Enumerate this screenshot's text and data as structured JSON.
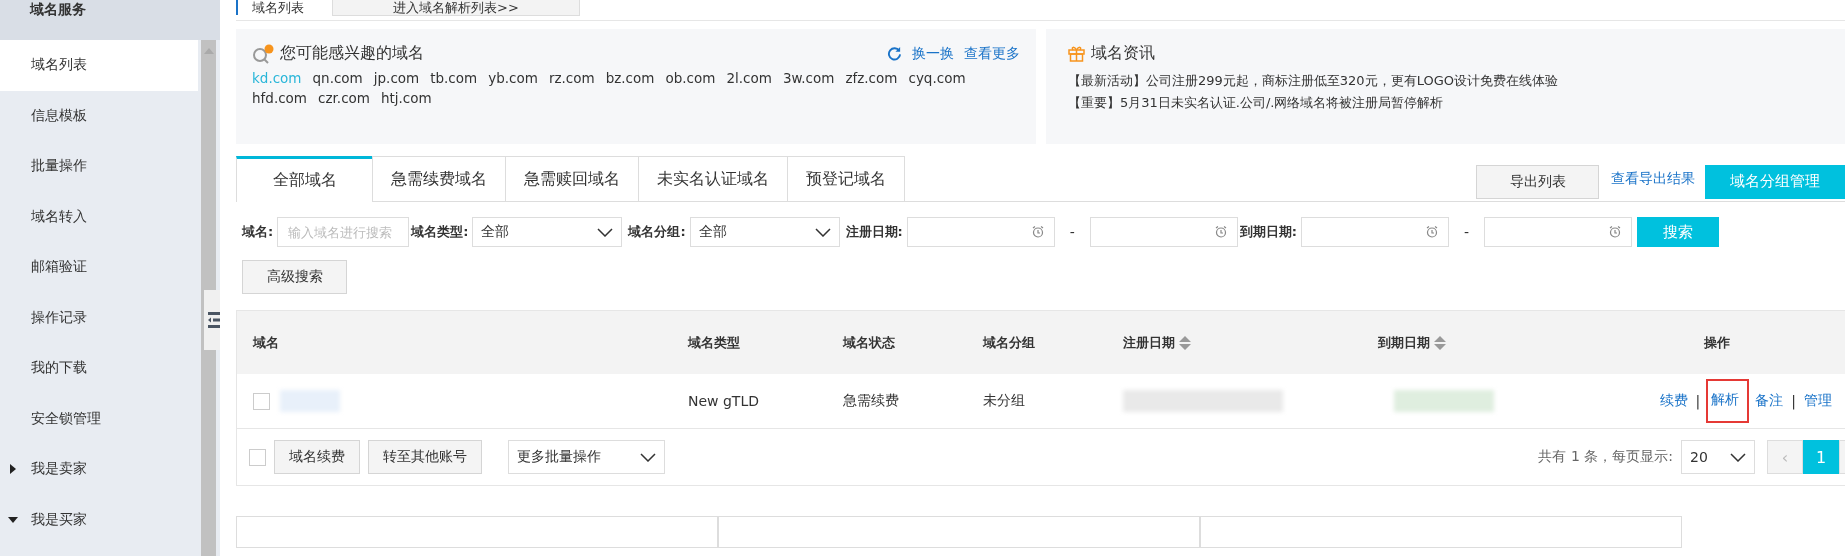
{
  "sidebar": {
    "title": "域名服务",
    "items": [
      {
        "label": "域名列表",
        "kind": "link",
        "selected": true
      },
      {
        "label": "信息模板",
        "kind": "link",
        "selected": false
      },
      {
        "label": "批量操作",
        "kind": "link",
        "selected": false
      },
      {
        "label": "域名转入",
        "kind": "link",
        "selected": false
      },
      {
        "label": "邮箱验证",
        "kind": "link",
        "selected": false
      },
      {
        "label": "操作记录",
        "kind": "link",
        "selected": false
      },
      {
        "label": "我的下载",
        "kind": "link",
        "selected": false
      },
      {
        "label": "安全锁管理",
        "kind": "link",
        "selected": false
      },
      {
        "label": "我是卖家",
        "kind": "group",
        "expanded": false,
        "selected": false
      },
      {
        "label": "我是买家",
        "kind": "group",
        "expanded": true,
        "selected": false
      }
    ]
  },
  "top_tabs": [
    {
      "label": "域名列表",
      "selected": true
    },
    {
      "label": "进入域名解析列表>>",
      "selected": false
    }
  ],
  "suggest": {
    "title": "您可能感兴趣的域名",
    "refresh": "换一换",
    "more": "查看更多",
    "domains": [
      {
        "name": "kd.com",
        "highlighted": true
      },
      {
        "name": "qn.com",
        "highlighted": false
      },
      {
        "name": "jp.com",
        "highlighted": false
      },
      {
        "name": "tb.com",
        "highlighted": false
      },
      {
        "name": "yb.com",
        "highlighted": false
      },
      {
        "name": "rz.com",
        "highlighted": false
      },
      {
        "name": "bz.com",
        "highlighted": false
      },
      {
        "name": "ob.com",
        "highlighted": false
      },
      {
        "name": "2l.com",
        "highlighted": false
      },
      {
        "name": "3w.com",
        "highlighted": false
      },
      {
        "name": "zfz.com",
        "highlighted": false
      },
      {
        "name": "cyq.com",
        "highlighted": false
      },
      {
        "name": "hfd.com",
        "highlighted": false
      },
      {
        "name": "czr.com",
        "highlighted": false
      },
      {
        "name": "htj.com",
        "highlighted": false
      }
    ]
  },
  "news": {
    "title": "域名资讯",
    "items": [
      "【最新活动】公司注册299元起，商标注册低至320元，更有LOGO设计免费在线体验",
      "【重要】5月31日未实名认证.公司/.网络域名将被注册局暂停解析"
    ]
  },
  "tabs": [
    {
      "label": "全部域名",
      "selected": true
    },
    {
      "label": "急需续费域名",
      "selected": false
    },
    {
      "label": "急需赎回域名",
      "selected": false
    },
    {
      "label": "未实名认证域名",
      "selected": false
    },
    {
      "label": "预登记域名",
      "selected": false
    }
  ],
  "toolbar": {
    "export": "导出列表",
    "export_result": "查看导出结果",
    "group_manage": "域名分组管理"
  },
  "filters": {
    "domain": {
      "label": "域名:",
      "placeholder": "输入域名进行搜索"
    },
    "type": {
      "label": "域名类型:",
      "value": "全部"
    },
    "group": {
      "label": "域名分组:",
      "value": "全部"
    },
    "reg_date": {
      "label": "注册日期:",
      "separator": "-"
    },
    "exp_date": {
      "label": "到期日期:",
      "separator": "-"
    },
    "search": "搜索",
    "advanced": "高级搜索"
  },
  "table": {
    "columns": [
      {
        "label": "域名",
        "sortable": false
      },
      {
        "label": "域名类型",
        "sortable": false
      },
      {
        "label": "域名状态",
        "sortable": false
      },
      {
        "label": "域名分组",
        "sortable": false
      },
      {
        "label": "注册日期",
        "sortable": true
      },
      {
        "label": "到期日期",
        "sortable": true
      },
      {
        "label": "操作",
        "sortable": false
      }
    ],
    "rows": [
      {
        "checked": false,
        "type": "New gTLD",
        "status": "急需续费",
        "group": "未分组",
        "actions": [
          {
            "label": "续费",
            "highlighted": false,
            "separator": "|"
          },
          {
            "label": "解析",
            "highlighted": true
          },
          {
            "label": "备注",
            "highlighted": false,
            "separator": "|"
          },
          {
            "label": "管理",
            "highlighted": false
          }
        ]
      }
    ]
  },
  "footer": {
    "select_all_checked": false,
    "buttons": [
      "域名续费",
      "转至其他账号"
    ],
    "batch": "更多批量操作",
    "total": "共有 1 条，每页显示:",
    "page_size": "20",
    "prev": "‹",
    "pages": [
      {
        "label": "1",
        "selected": true
      }
    ]
  }
}
